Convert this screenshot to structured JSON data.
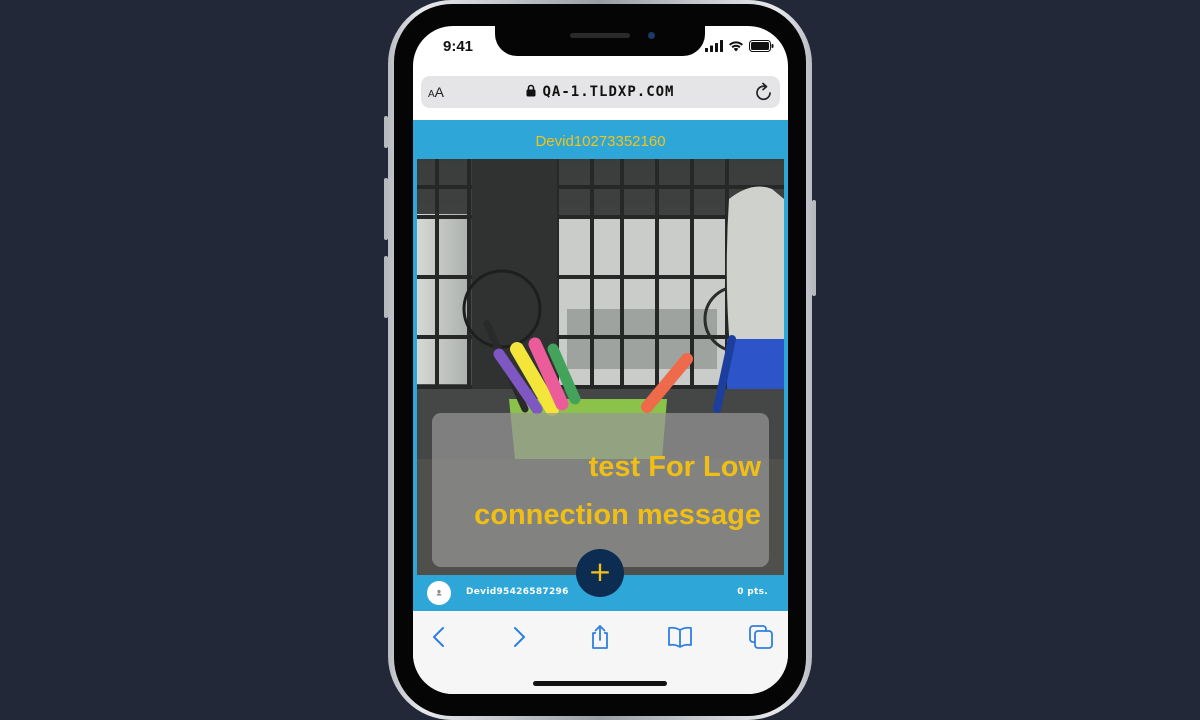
{
  "status_bar": {
    "time": "9:41"
  },
  "browser": {
    "text_size_small": "A",
    "text_size_large": "A",
    "url": "QA-1.TLDXP.COM"
  },
  "page": {
    "header_title": "Devid10273352160",
    "overlay_message": "test For Low connection message",
    "fab_label": "+",
    "bottom_bar": {
      "username": "Devid95426587296",
      "points": "0 pts."
    }
  },
  "colors": {
    "accent_blue": "#2ea7d8",
    "accent_yellow": "#f2c21a",
    "fab_navy": "#0d2c52",
    "safari_blue": "#2f7fe0",
    "background": "#222838"
  },
  "icons": {
    "status": [
      "signal-bars-icon",
      "wifi-icon",
      "battery-icon"
    ],
    "url_bar": [
      "lock-icon",
      "reload-icon"
    ],
    "toolbar": [
      "back-chevron-icon",
      "forward-chevron-icon",
      "share-icon",
      "bookmarks-icon",
      "tabs-icon"
    ]
  }
}
